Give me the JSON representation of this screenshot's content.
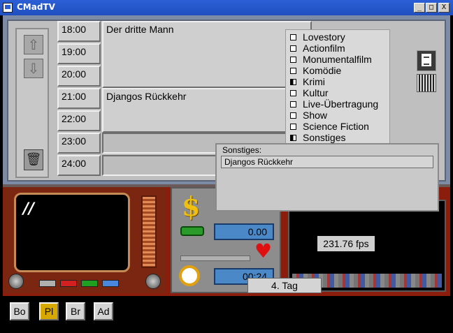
{
  "window": {
    "title": "CMadTV",
    "minimize_glyph": "_",
    "maximize_glyph": "□",
    "close_glyph": "X"
  },
  "schedule": {
    "times": [
      "18:00",
      "19:00",
      "20:00",
      "21:00",
      "22:00",
      "23:00",
      "24:00"
    ],
    "programs": [
      {
        "title": "Der dritte Mann",
        "start": "18:00"
      },
      {
        "title": "Djangos Rückkehr",
        "start": "21:00"
      }
    ]
  },
  "genres": [
    {
      "label": "Lovestory",
      "checked": false
    },
    {
      "label": "Actionfilm",
      "checked": false
    },
    {
      "label": "Monumentalfilm",
      "checked": false
    },
    {
      "label": "Komödie",
      "checked": false
    },
    {
      "label": "Krimi",
      "checked": true
    },
    {
      "label": "Kultur",
      "checked": false
    },
    {
      "label": "Live-Übertragung",
      "checked": false
    },
    {
      "label": "Show",
      "checked": false
    },
    {
      "label": "Science Fiction",
      "checked": false
    },
    {
      "label": "Sonstiges",
      "checked": true
    }
  ],
  "sonstiges": {
    "label": "Sonstiges:",
    "items": [
      "Djangos Rückkehr"
    ]
  },
  "finance": {
    "money": "0.00",
    "time": "00:24"
  },
  "game": {
    "fps": "231.76 fps",
    "day": "4. Tag"
  },
  "nav": [
    {
      "label": "Bo",
      "active": false
    },
    {
      "label": "Pl",
      "active": true
    },
    {
      "label": "Br",
      "active": false
    },
    {
      "label": "Ad",
      "active": false
    }
  ],
  "colors": {
    "titlebar": "#2c5fd6",
    "planner_bg": "#bfbfbf",
    "bottom_bg": "#8a1d0c",
    "active_nav": "#d7a800",
    "value_box": "#4a88c8"
  }
}
